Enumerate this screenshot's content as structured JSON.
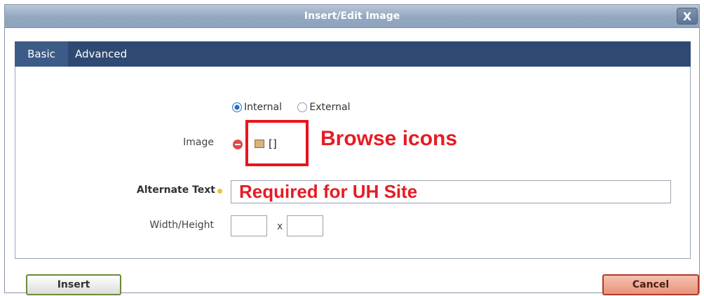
{
  "dialog": {
    "title": "Insert/Edit Image",
    "close_label": "X"
  },
  "tabs": [
    {
      "label": "Basic",
      "active": true
    },
    {
      "label": "Advanced",
      "active": false
    }
  ],
  "source": {
    "options": [
      {
        "label": "Internal",
        "checked": true
      },
      {
        "label": "External",
        "checked": false
      }
    ]
  },
  "image": {
    "label": "Image",
    "value": "[]",
    "icons": [
      "remove-icon",
      "browse-image-icon"
    ]
  },
  "alt_text": {
    "label": "Alternate Text",
    "value": ""
  },
  "dimensions": {
    "label": "Width/Height",
    "separator": "x",
    "width": "",
    "height": ""
  },
  "annotations": {
    "browse": "Browse icons",
    "required": "Required for UH Site",
    "color": "#e61c24"
  },
  "buttons": {
    "insert": "Insert",
    "cancel": "Cancel"
  }
}
